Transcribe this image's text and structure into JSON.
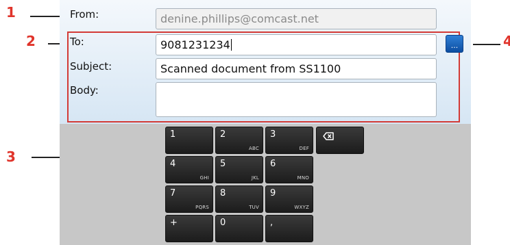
{
  "callouts": [
    "1",
    "2",
    "3",
    "4"
  ],
  "form": {
    "from_label": "From:",
    "from_value": "denine.phillips@comcast.net",
    "to_label": "To:",
    "to_value": "9081231234",
    "subject_label": "Subject:",
    "subject_value": "Scanned document from SS1100",
    "body_label": "Body:",
    "body_value": ""
  },
  "contacts_button": {
    "icon": "ellipsis-icon",
    "label": "..."
  },
  "keypad": {
    "keys": [
      {
        "main": "1",
        "sub": ""
      },
      {
        "main": "2",
        "sub": "ABC"
      },
      {
        "main": "3",
        "sub": "DEF"
      },
      {
        "main": "4",
        "sub": "GHI"
      },
      {
        "main": "5",
        "sub": "JKL"
      },
      {
        "main": "6",
        "sub": "MNO"
      },
      {
        "main": "7",
        "sub": "PQRS"
      },
      {
        "main": "8",
        "sub": "TUV"
      },
      {
        "main": "9",
        "sub": "WXYZ"
      },
      {
        "main": "+",
        "sub": ""
      },
      {
        "main": "0",
        "sub": ""
      },
      {
        "main": ",",
        "sub": ""
      }
    ],
    "backspace_icon": "backspace-icon"
  },
  "colors": {
    "callout": "#e0342b",
    "highlight": "#d33a35",
    "key": "#2a2a2a",
    "accent": "#1a63c0"
  }
}
